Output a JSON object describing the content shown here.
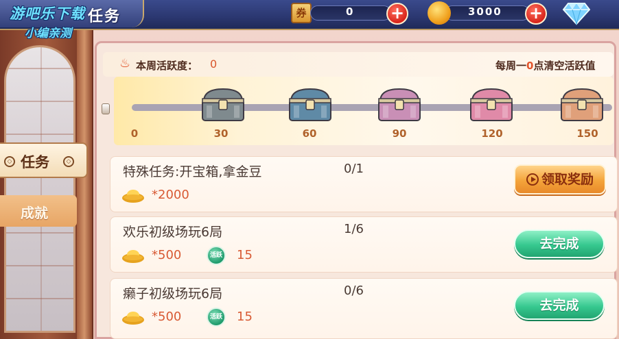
{
  "watermark": {
    "line1": "游吧乐下载",
    "line2": "小编亲测"
  },
  "header": {
    "title": "任务",
    "coupon_icon_label": "券",
    "coupon_value": "0",
    "bean_value": "3000",
    "plus_label": "+",
    "icons": [
      "coupon-icon",
      "gold-bean-icon",
      "diamond-icon"
    ]
  },
  "sidebar": {
    "tabs": [
      {
        "label": "任务",
        "selected": true
      },
      {
        "label": "成就",
        "selected": false
      }
    ]
  },
  "activity": {
    "label": "本周活跃度：",
    "value": "0",
    "reset_prefix": "每周一",
    "reset_highlight": "0",
    "reset_suffix": "点清空活跃值",
    "progress_fraction": 0,
    "milestones": [
      "0",
      "30",
      "60",
      "90",
      "120",
      "150"
    ],
    "chest_colors": [
      "#7f8a8e",
      "#5f8aa6",
      "#c98fb6",
      "#e08aa8",
      "#e0a07a"
    ]
  },
  "tasks": [
    {
      "name": "特殊任务:开宝箱,拿金豆",
      "progress": "0/1",
      "gold": "*2000",
      "active": null,
      "button": "领取奖励",
      "button_type": "claim"
    },
    {
      "name": "欢乐初级场玩6局",
      "progress": "1/6",
      "gold": "*500",
      "active": "15",
      "button": "去完成",
      "button_type": "go"
    },
    {
      "name": "癞子初级场玩6局",
      "progress": "0/6",
      "gold": "*500",
      "active": "15",
      "button": "去完成",
      "button_type": "go"
    }
  ],
  "active_icon_label": "活跃",
  "colors": {
    "accent_orange": "#d85a34",
    "go_green": "#36c88f",
    "claim_orange": "#f4a43a",
    "topbar_blue": "#2b3770"
  }
}
